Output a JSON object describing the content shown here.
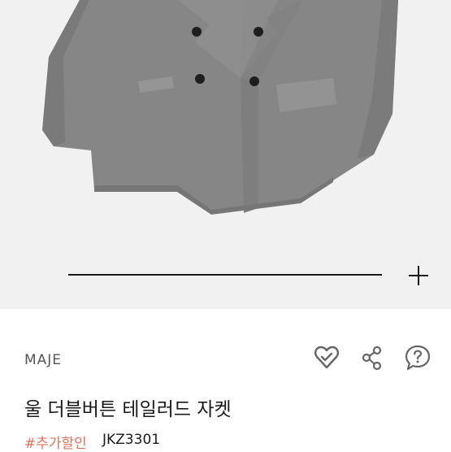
{
  "product": {
    "brand": "MAJE",
    "title": "울 더블버튼 테일러드 자켓",
    "tag": "#추가할인",
    "code": "JKZ3301"
  },
  "colors": {
    "jacket": "#858585",
    "background": "#f1f1f1",
    "tag": "#e1735a"
  },
  "icons": [
    "heart-icon",
    "share-icon",
    "help-icon",
    "plus-icon"
  ]
}
